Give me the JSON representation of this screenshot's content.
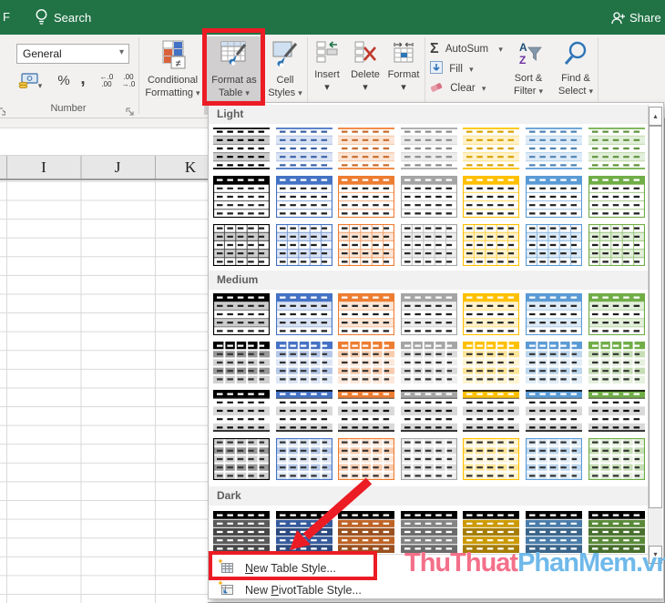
{
  "titlebar": {
    "bg": "#217346",
    "window_letter": "F",
    "search_label": "Search",
    "share_label": "Share"
  },
  "glyphs": {
    "dropdown": "▾",
    "up_arrow": "▴",
    "down_arrow": "▾",
    "sigma": "Σ"
  },
  "ribbon": {
    "number_group": {
      "format_value": "General",
      "percent": "%",
      "comma": ",",
      "increase_decimal_top": "←.0",
      "increase_decimal_bottom": ".00",
      "decrease_decimal_top": ".00",
      "decrease_decimal_bottom": "→.0",
      "label": "Number"
    },
    "styles_group": {
      "conditional_formatting": [
        "Conditional",
        "Formatting"
      ],
      "format_as_table": [
        "Format as",
        "Table"
      ],
      "cell_styles": [
        "Cell",
        "Styles"
      ]
    },
    "cells_group": {
      "insert": "Insert",
      "delete": "Delete",
      "format": "Format"
    },
    "editing_group": {
      "autosum": "AutoSum",
      "fill": "Fill",
      "clear": "Clear",
      "sort_filter": [
        "Sort &",
        "Filter"
      ],
      "find_select": [
        "Find &",
        "Select"
      ]
    }
  },
  "sheet": {
    "columns": [
      "I",
      "J",
      "K"
    ]
  },
  "gallery": {
    "palette": {
      "bw": "#000000",
      "blue": "#4472C4",
      "orange": "#ED7D31",
      "gray": "#A5A5A5",
      "gold": "#FFC000",
      "lightblue": "#5B9BD5",
      "green": "#70AD47"
    },
    "palette_order": [
      "bw",
      "blue",
      "orange",
      "gray",
      "gold",
      "lightblue",
      "green"
    ],
    "sections": [
      {
        "name": "Light",
        "variants": [
          "banded-lines",
          "header-solid",
          "grid-banded"
        ]
      },
      {
        "name": "Medium",
        "variants": [
          "header-banded",
          "header-checker",
          "header-bar",
          "grid-full"
        ]
      },
      {
        "name": "Dark",
        "variants": [
          "dark-solid"
        ]
      }
    ],
    "menu": [
      {
        "label": "New Table Style...",
        "accel_index": 0
      },
      {
        "label": "New PivotTable Style...",
        "accel_index": 4
      }
    ]
  },
  "annotations": {
    "color": "#EC1C24"
  },
  "watermark": {
    "part1": "ThuThuat",
    "part2": "PhanMem.vn",
    "color1": "#F4708A",
    "color2": "#6FB9EA"
  }
}
